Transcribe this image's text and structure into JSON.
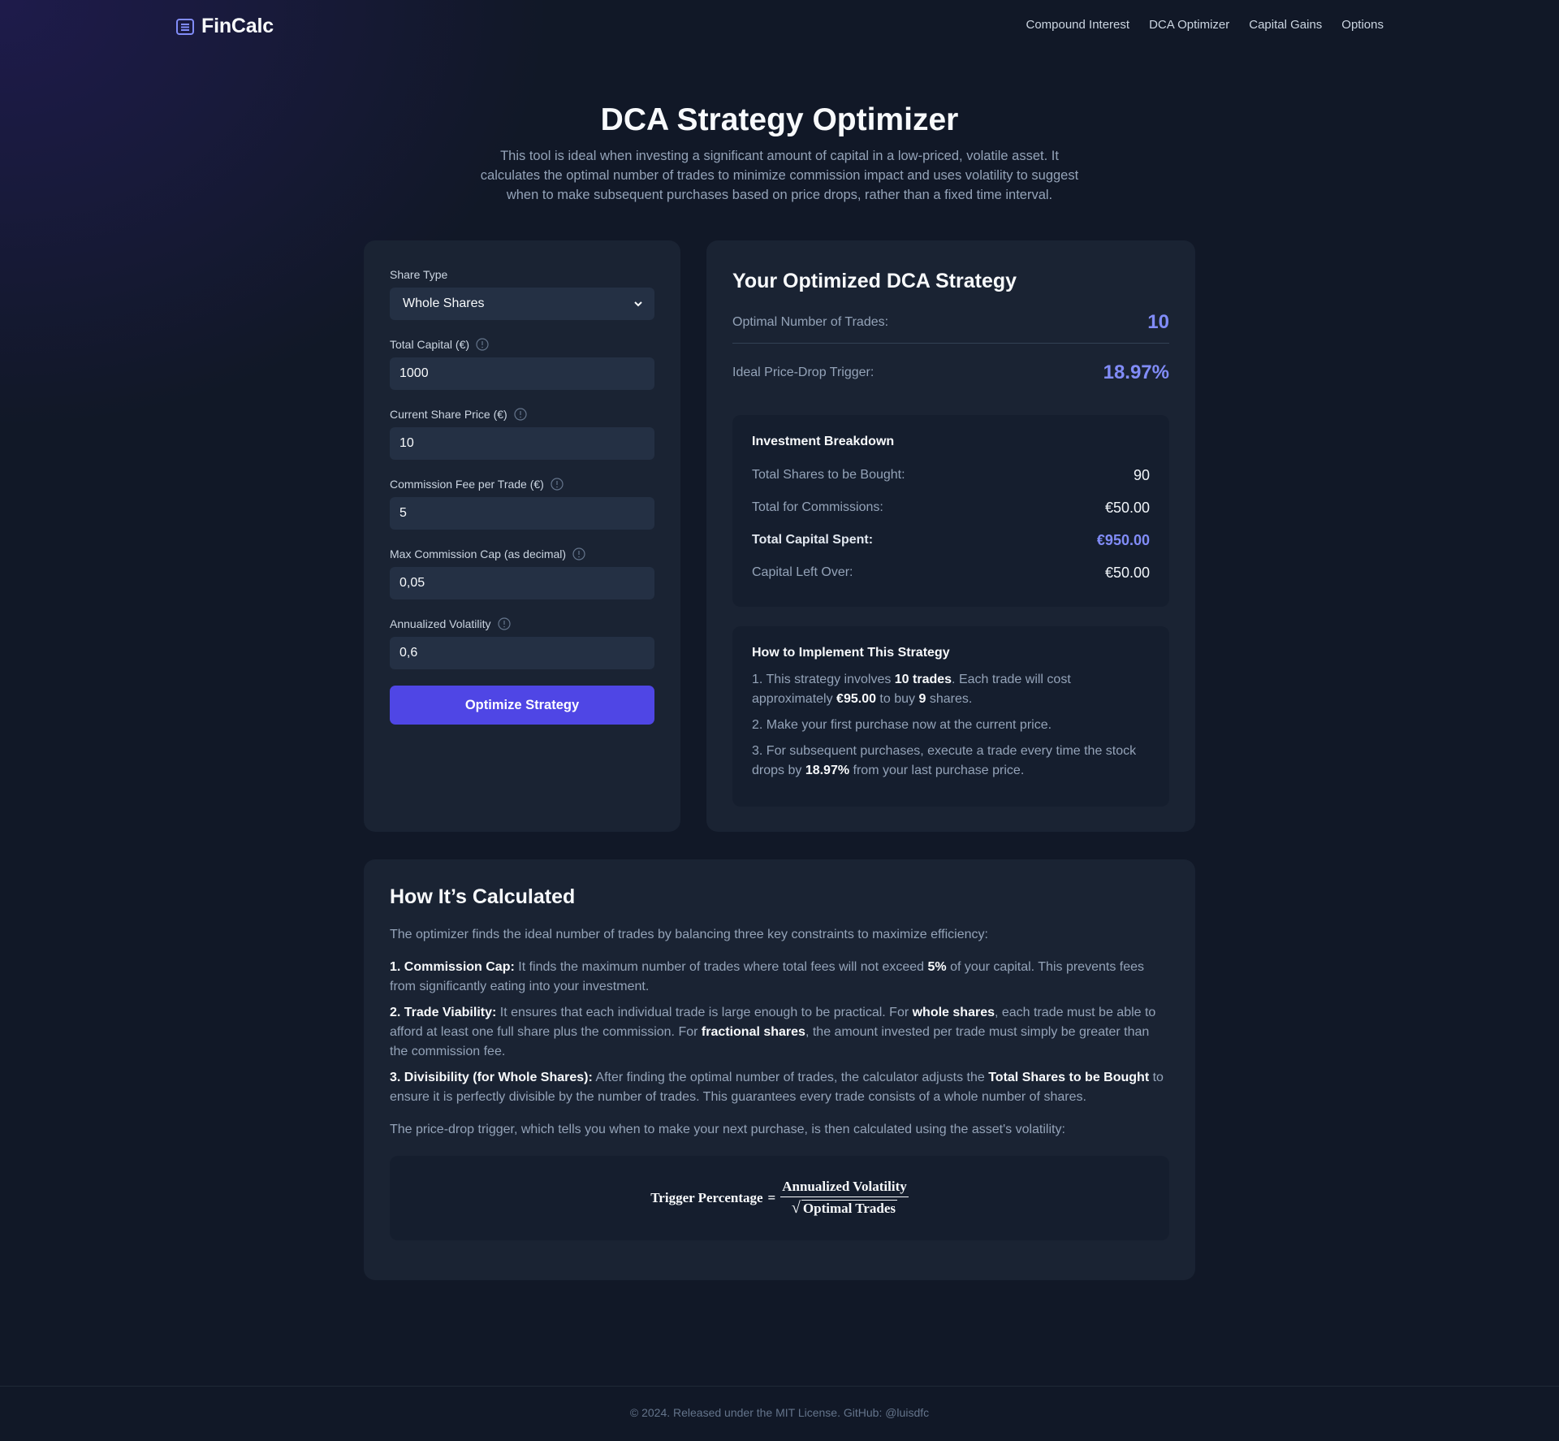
{
  "nav": {
    "brand": "FinCalc",
    "links": [
      "Compound Interest",
      "DCA Optimizer",
      "Capital Gains",
      "Options"
    ]
  },
  "hero": {
    "title": "DCA Strategy Optimizer",
    "description": "This tool is ideal when investing a significant amount of capital in a low-priced, volatile asset. It calculates the optimal number of trades to minimize commission impact and uses volatility to suggest when to make subsequent purchases based on price drops, rather than a fixed time interval."
  },
  "form": {
    "share_type_label": "Share Type",
    "share_type_value": "Whole Shares",
    "total_capital_label": "Total Capital (€)",
    "total_capital_value": "1000",
    "share_price_label": "Current Share Price (€)",
    "share_price_value": "10",
    "commission_label": "Commission Fee per Trade (€)",
    "commission_value": "5",
    "max_cap_label": "Max Commission Cap (as decimal)",
    "max_cap_value": "0,05",
    "volatility_label": "Annualized Volatility",
    "volatility_value": "0,6",
    "submit_label": "Optimize Strategy"
  },
  "results": {
    "title": "Your Optimized DCA Strategy",
    "trades_label": "Optimal Number of Trades:",
    "trades_value": "10",
    "trigger_label": "Ideal Price-Drop Trigger:",
    "trigger_value": "18.97%",
    "breakdown": {
      "title": "Investment Breakdown",
      "rows": [
        {
          "label": "Total Shares to be Bought:",
          "value": "90"
        },
        {
          "label": "Total for Commissions:",
          "value": "€50.00"
        },
        {
          "label": "Total Capital Spent:",
          "value": "€950.00"
        },
        {
          "label": "Capital Left Over:",
          "value": "€50.00"
        }
      ]
    },
    "implement": {
      "title": "How to Implement This Strategy",
      "step1": {
        "a": "1. This strategy involves ",
        "b": "10 trades",
        "c": ". Each trade will cost approximately ",
        "d": "€95.00",
        "e": " to buy ",
        "f": "9",
        "g": " shares."
      },
      "step2": "2. Make your first purchase now at the current price.",
      "step3": {
        "a": "3. For subsequent purchases, execute a trade every time the stock drops by ",
        "b": "18.97%",
        "c": " from your last purchase price."
      }
    }
  },
  "calc": {
    "title": "How It’s Calculated",
    "intro": "The optimizer finds the ideal number of trades by balancing three key constraints to maximize efficiency:",
    "p1": {
      "a": "1. Commission Cap:",
      "b": " It finds the maximum number of trades where total fees will not exceed ",
      "c": "5%",
      "d": " of your capital. This prevents fees from significantly eating into your investment."
    },
    "p2": {
      "a": "2. Trade Viability:",
      "b": " It ensures that each individual trade is large enough to be practical. For ",
      "c": "whole shares",
      "d": ", each trade must be able to afford at least one full share plus the commission. For ",
      "e": "fractional shares",
      "f": ", the amount invested per trade must simply be greater than the commission fee."
    },
    "p3": {
      "a": "3. Divisibility (for Whole Shares):",
      "b": " After finding the optimal number of trades, the calculator adjusts the ",
      "c": "Total Shares to be Bought",
      "d": " to ensure it is perfectly divisible by the number of trades. This guarantees every trade consists of a whole number of shares."
    },
    "outro": "The price-drop trigger, which tells you when to make your next purchase, is then calculated using the asset's volatility:",
    "formula": {
      "lhs": "Trigger Percentage",
      "eq": "=",
      "numerator": "Annualized Volatility",
      "denominator": "Optimal Trades"
    }
  },
  "footer": {
    "text": "© 2024. Released under the MIT License. GitHub: @luisdfc"
  },
  "colors": {
    "accent": "#4f46e5",
    "highlight": "#818cf8",
    "background": "#111827",
    "card": "#1a2333"
  }
}
